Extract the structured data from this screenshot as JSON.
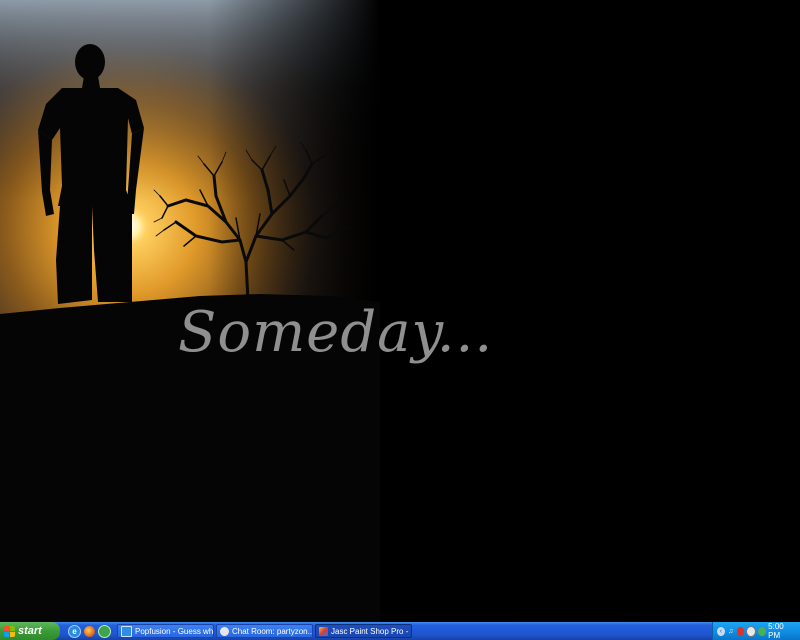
{
  "wallpaper": {
    "caption": "Someday..."
  },
  "taskbar": {
    "start_label": "start",
    "quick_launch": [
      {
        "icon": "ie-icon"
      },
      {
        "icon": "firefox-icon"
      },
      {
        "icon": "messenger-icon"
      }
    ],
    "tasks": [
      {
        "label": "Popfusion - Guess wh...",
        "icon": "ie-page-icon",
        "active": false
      },
      {
        "label": "Chat Room: partyzon...",
        "icon": "chat-icon",
        "active": false
      },
      {
        "label": "Jasc Paint Shop Pro - ...",
        "icon": "paint-shop-icon",
        "active": true
      }
    ],
    "tray_icons": [
      "expand-arrow-icon",
      "music-icon",
      "security-icon",
      "antivirus-icon",
      "messenger-status-icon"
    ],
    "clock": "5:00 PM"
  },
  "colors": {
    "taskbar_blue": "#245edb",
    "start_green": "#3c9b38",
    "tray_blue": "#0f8ae2",
    "caption_gray": "#8f8f8f"
  }
}
